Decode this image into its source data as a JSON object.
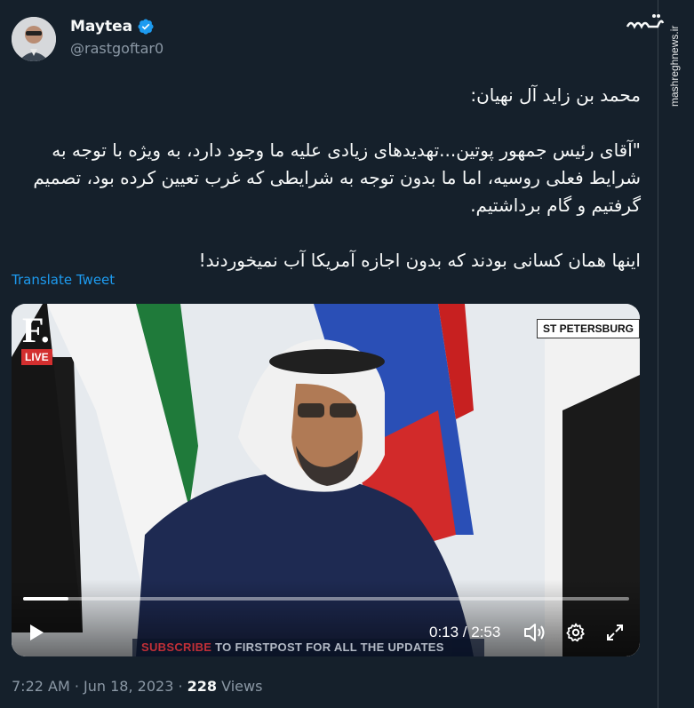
{
  "user": {
    "display_name": "Maytea",
    "handle": "@rastgoftar0",
    "verified": true
  },
  "tweet": {
    "lines": [
      "محمد بن زاید آل نهیان:",
      "",
      "\"آقای رئیس جمهور پوتین...تهدیدهای زیادی علیه ما وجود دارد، به ویژه با توجه به شرایط فعلی روسیه، اما ما بدون توجه به شرایطی که غرب تعیین کرده بود، تصمیم گرفتیم و گام برداشتیم.",
      "",
      "اینها همان کسانی بودند که بدون اجازه آمریکا آب نمیخوردند!"
    ],
    "translate_label": "Translate Tweet"
  },
  "video": {
    "live_label": "LIVE",
    "location_label": "ST PETERSBURG",
    "subscribe_red": "SUBSCRIBE",
    "subscribe_rest": " TO FIRSTPOST FOR ALL THE UPDATES",
    "elapsed": "0:13",
    "duration": "2:53",
    "time_display": "0:13 / 2:53",
    "progress": 0.075,
    "logo_letter": "F."
  },
  "meta": {
    "time": "7:22 AM",
    "separator": " · ",
    "date": "Jun 18, 2023",
    "views_count": "228",
    "views_label": " Views"
  },
  "watermark": {
    "logo_text": "مشرق",
    "url": "mashreghnews.ir"
  },
  "colors": {
    "background": "#15202b",
    "accent": "#1d9bf0",
    "secondary_text": "#8b98a5"
  }
}
